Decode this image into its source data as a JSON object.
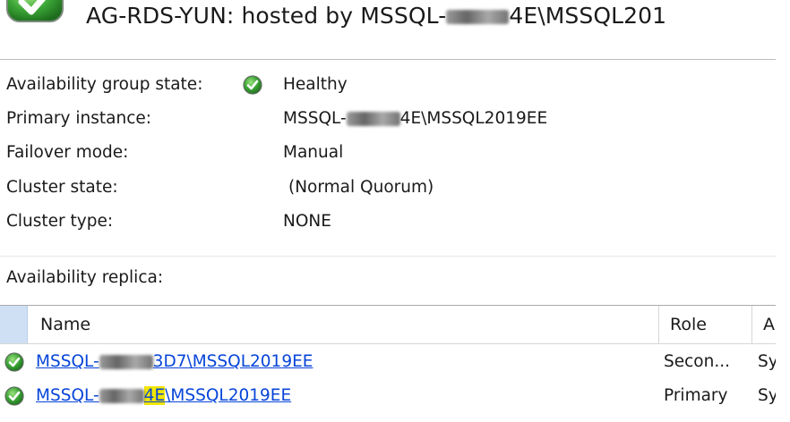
{
  "header": {
    "title": "AG-RDS-YUN: hosted by MSSQL-",
    "title_tail": "4E\\MSSQL201",
    "icon": "green-check-icon"
  },
  "properties": [
    {
      "label": "Availability group state:",
      "value": "Healthy",
      "icon": "green-check-icon"
    },
    {
      "label": "Primary instance:",
      "value_prefix": "MSSQL-",
      "value_suffix": "4E\\MSSQL2019EE"
    },
    {
      "label": "Failover mode:",
      "value": "Manual"
    },
    {
      "label": "Cluster state:",
      "value": "(Normal Quorum)"
    },
    {
      "label": "Cluster type:",
      "value": "NONE"
    }
  ],
  "replica_section_label": "Availability replica:",
  "grid": {
    "columns": [
      "Name",
      "Role",
      "A"
    ],
    "rows": [
      {
        "name_prefix": "MSSQL-",
        "name_suffix": "3D7\\MSSQL2019EE",
        "role": "Secon...",
        "avail": "Sy",
        "icon": "green-check-icon"
      },
      {
        "name_prefix": "MSSQL-",
        "name_mid": "4E",
        "name_suffix": "\\MSSQL2019EE",
        "role": "Primary",
        "avail": "Sy",
        "icon": "green-check-icon"
      }
    ]
  },
  "colors": {
    "accent": "#0645d8",
    "check_green": "#3aa335",
    "highlight": "#f2e600"
  }
}
